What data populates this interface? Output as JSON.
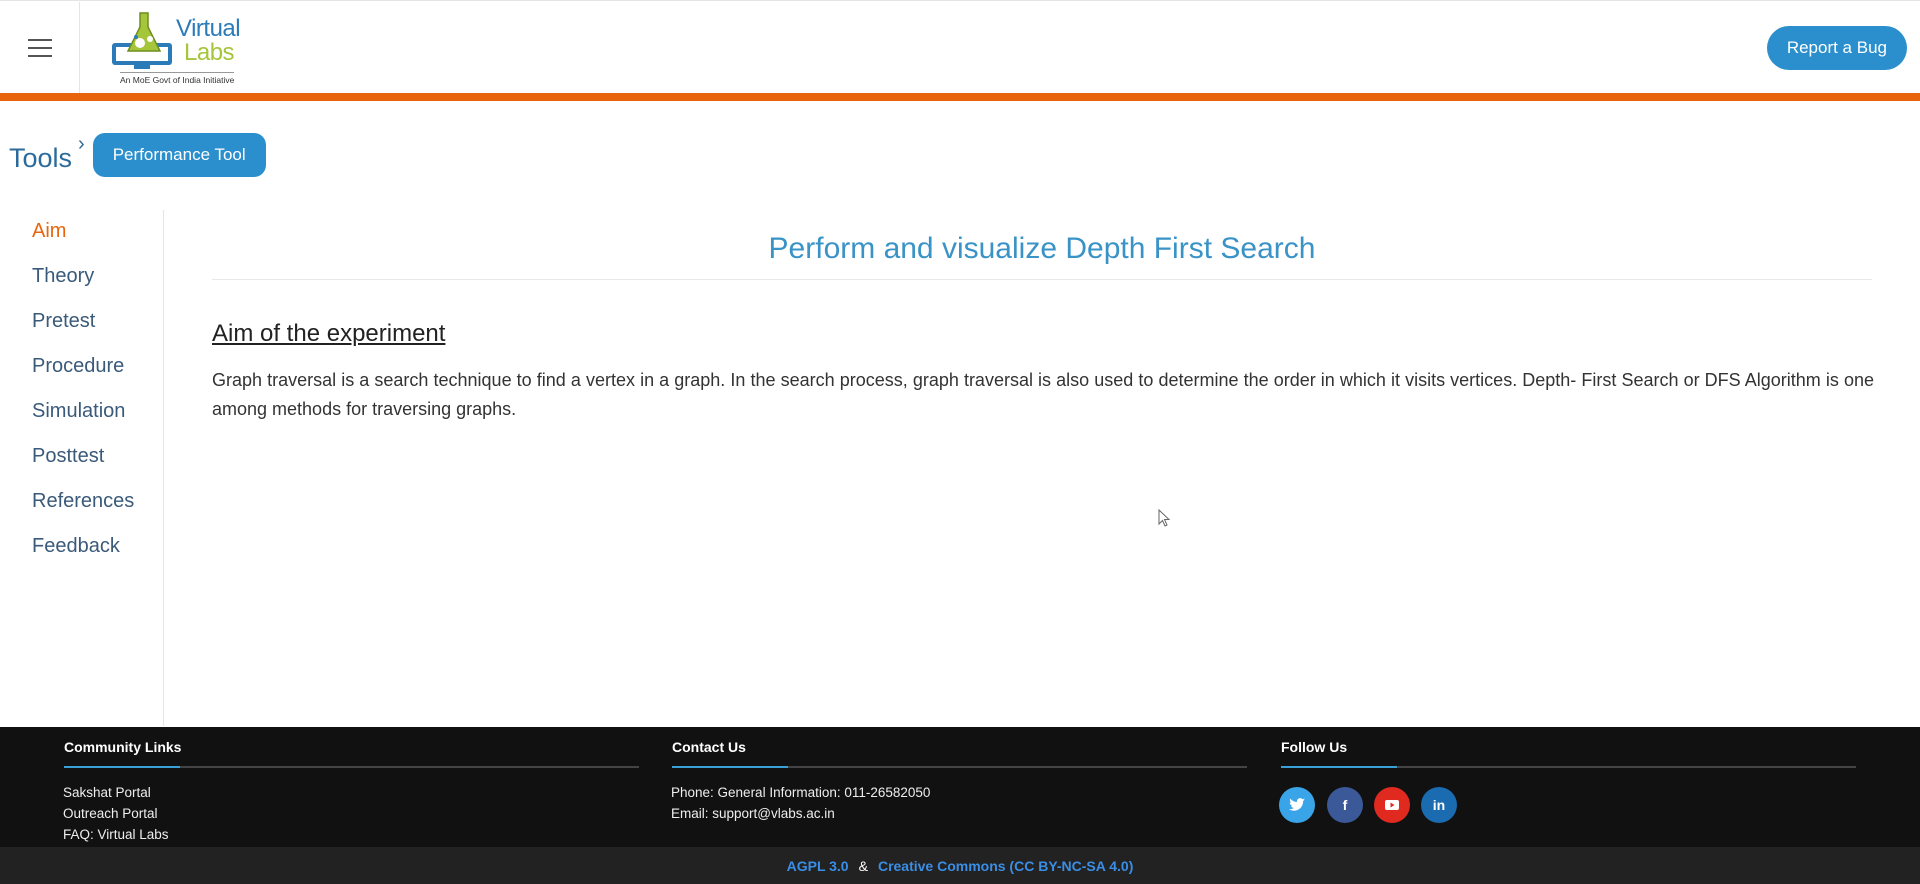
{
  "header": {
    "logo_line1": "Virtual",
    "logo_line2": "Labs",
    "logo_tagline": "An MoE Govt of India Initiative",
    "report_bug": "Report a Bug"
  },
  "breadcrumb": {
    "tools": "Tools",
    "current": "Performance Tool"
  },
  "sidebar": {
    "items": [
      {
        "label": "Aim",
        "active": true
      },
      {
        "label": "Theory"
      },
      {
        "label": "Pretest"
      },
      {
        "label": "Procedure"
      },
      {
        "label": "Simulation"
      },
      {
        "label": "Posttest"
      },
      {
        "label": "References"
      },
      {
        "label": "Feedback"
      }
    ]
  },
  "main": {
    "title": "Perform and visualize Depth First Search",
    "section_heading": "Aim of the experiment",
    "body": "Graph traversal is a search technique to find a vertex in a graph. In the search process, graph traversal is also used to determine the order in which it visits vertices. Depth- First Search or DFS Algorithm is one among methods for traversing graphs."
  },
  "footer": {
    "community": {
      "heading": "Community Links",
      "links": [
        "Sakshat Portal",
        "Outreach Portal",
        "FAQ: Virtual Labs"
      ]
    },
    "contact": {
      "heading": "Contact Us",
      "phone": "Phone: General Information: 011-26582050",
      "email": "Email: support@vlabs.ac.in"
    },
    "follow": {
      "heading": "Follow Us",
      "icons": [
        "twitter-icon",
        "facebook-icon",
        "youtube-icon",
        "linkedin-icon"
      ]
    },
    "license": {
      "agpl": "AGPL 3.0",
      "amp": "&",
      "cc": "Creative Commons (CC BY-NC-SA 4.0)"
    }
  },
  "colors": {
    "accent_orange": "#e8650d",
    "brand_blue": "#2a8fcc",
    "title_blue": "#3a93c7",
    "footer_bg": "#111111"
  }
}
